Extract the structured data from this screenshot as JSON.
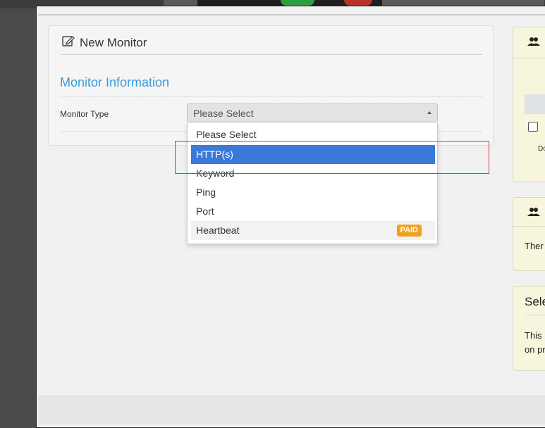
{
  "form": {
    "title": "New Monitor",
    "section_title": "Monitor Information",
    "monitor_type_label": "Monitor Type",
    "selected_value": "Please Select"
  },
  "dropdown": {
    "options": [
      {
        "label": "Please Select"
      },
      {
        "label": "HTTP(s)"
      },
      {
        "label": "Keyword"
      },
      {
        "label": "Ping"
      },
      {
        "label": "Port"
      },
      {
        "label": "Heartbeat",
        "badge": "PAID"
      }
    ],
    "highlighted_index": 1
  },
  "right_panels": {
    "panel3_title": "Sele",
    "panel2_text": "Ther",
    "panel3_line1": "This",
    "panel3_line2": "on pr",
    "panel1_small": "Do"
  },
  "colors": {
    "accent": "#3a9ad9",
    "selected_option": "#3b78d8",
    "badge": "#f0a020",
    "highlight_box": "#d9363e",
    "note_panel": "#f7f6dc"
  }
}
